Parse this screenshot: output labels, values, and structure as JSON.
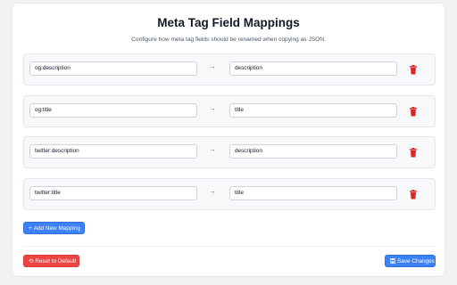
{
  "header": {
    "title": "Meta Tag Field Mappings",
    "subtitle": "Configure how meta tag fields should be renamed when copying as JSON."
  },
  "mappings": [
    {
      "from": "og:description",
      "to": "description"
    },
    {
      "from": "og:title",
      "to": "title"
    },
    {
      "from": "twitter:description",
      "to": "description"
    },
    {
      "from": "twitter:title",
      "to": "title"
    }
  ],
  "arrow_glyph": "→",
  "actions": {
    "add_label": "Add New Mapping",
    "add_icon": "+",
    "reset_label": "Reset to Default",
    "reset_icon": "⟲",
    "save_label": "Save Changes"
  },
  "colors": {
    "primary": "#3b82f6",
    "danger": "#ef4444",
    "trash_icon": "#dc2626"
  }
}
